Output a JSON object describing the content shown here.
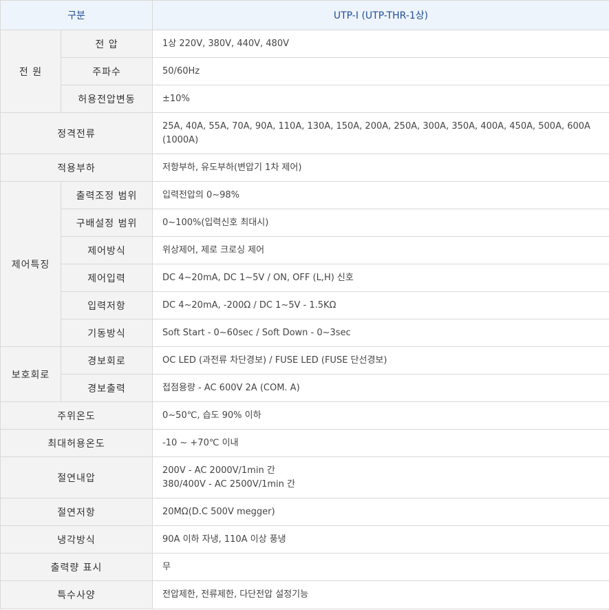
{
  "header": {
    "category_label": "구분",
    "model_label": "UTP-I (UTP-THR-1상)"
  },
  "groups": {
    "power": "전 원",
    "control": "제어특징",
    "protection": "보호회로"
  },
  "rows": {
    "voltage": {
      "label": "전 압",
      "value": "1상 220V, 380V, 440V, 480V"
    },
    "frequency": {
      "label": "주파수",
      "value": "50/60Hz"
    },
    "voltage_tolerance": {
      "label": "허용전압변동",
      "value": "±10%"
    },
    "rated_current": {
      "label": "정격전류",
      "value": "25A, 40A, 55A, 70A, 90A, 110A, 130A, 150A, 200A, 250A, 300A, 350A, 400A, 450A, 500A, 600A (1000A)"
    },
    "load": {
      "label": "적용부하",
      "value": "저항부하, 유도부하(변압기 1차 제어)"
    },
    "output_range": {
      "label": "출력조정 범위",
      "value": "입력전압의 0~98%"
    },
    "gradient_range": {
      "label": "구배설정 범위",
      "value": "0~100%(입력신호 최대시)"
    },
    "control_method": {
      "label": "제어방식",
      "value": "위상제어, 제로 크로싱 제어"
    },
    "control_input": {
      "label": "제어입력",
      "value": "DC 4~20mA, DC 1~5V / ON, OFF (L,H) 신호"
    },
    "input_resistance": {
      "label": "입력저항",
      "value": "DC 4~20mA, -200Ω / DC 1~5V - 1.5KΩ"
    },
    "start_method": {
      "label": "기동방식",
      "value": "Soft Start - 0~60sec / Soft Down - 0~3sec"
    },
    "alarm_circuit": {
      "label": "경보회로",
      "value": "OC LED (과전류 차단경보) / FUSE LED (FUSE 단선경보)"
    },
    "alarm_output": {
      "label": "경보출력",
      "value": "접점용량 - AC 600V 2A (COM. A)"
    },
    "ambient_temp": {
      "label": "주위온도",
      "value": "0~50℃, 습도 90% 이하"
    },
    "max_temp": {
      "label": "최대허용온도",
      "value": "-10 ~ +70℃ 이내"
    },
    "dielectric_strength": {
      "label": "절연내압",
      "value_line1": "200V - AC 2000V/1min 간",
      "value_line2": "380/400V - AC 2500V/1min 간"
    },
    "insulation_resistance": {
      "label": "절연저항",
      "value": "20MΩ(D.C 500V megger)"
    },
    "cooling": {
      "label": "냉각방식",
      "value": "90A 이하 자냉, 110A 이상 풍냉"
    },
    "output_display": {
      "label": "출력량 표시",
      "value": "무"
    },
    "special": {
      "label": "특수사양",
      "value": "전압제한, 전류제한, 다단전압 설정기능"
    }
  }
}
